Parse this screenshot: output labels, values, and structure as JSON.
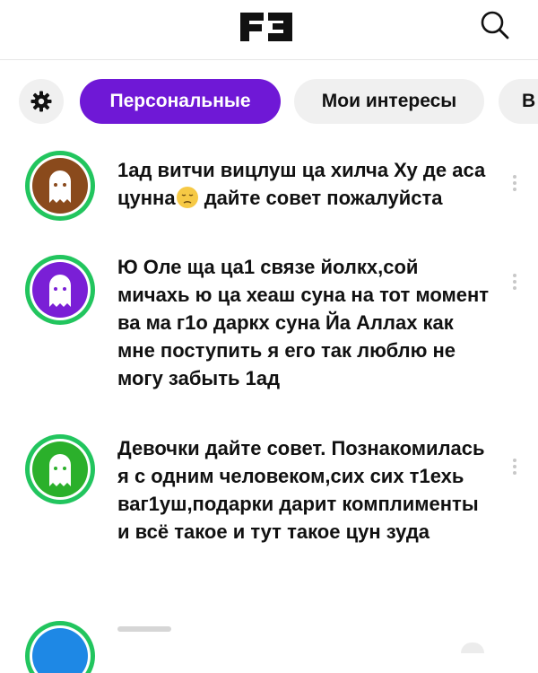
{
  "header": {
    "logo_icon": "fb-logo-icon",
    "search_icon": "search-icon"
  },
  "tabs": {
    "settings_icon": "gear-icon",
    "items": [
      {
        "label": "Персональные",
        "active": true
      },
      {
        "label": "Мои интересы",
        "active": false
      },
      {
        "label": "В",
        "active": false
      }
    ]
  },
  "posts": [
    {
      "avatar_color": "#8a4a1c",
      "ring_color": "#22c55e",
      "text_before_emoji": "1ад витчи вицлуш ца хилча Ху де аса цунна",
      "emoji": "pensive-face-emoji",
      "text_after_emoji": " дайте совет пожалуйста"
    },
    {
      "avatar_color": "#7a1fd6",
      "ring_color": "#22c55e",
      "text": "Ю Оле ща ца1 связе йолкх,сой мичахь ю ца хеаш суна на тот момент ва ма г1о даркх суна Йа Аллах как мне поступить я его так люблю не могу забыть 1ад"
    },
    {
      "avatar_color": "#2bb02b",
      "ring_color": "#22c55e",
      "text": "Девочки дайте совет. Познакомилась я с одним человеком,сих сих т1ехь ваг1уш,подарки дарит комплименты и всё такое и тут такое цун зуда"
    }
  ],
  "colors": {
    "accent": "#6f18d6",
    "chip_bg": "#f0f0f0",
    "online_ring": "#22c55e"
  }
}
